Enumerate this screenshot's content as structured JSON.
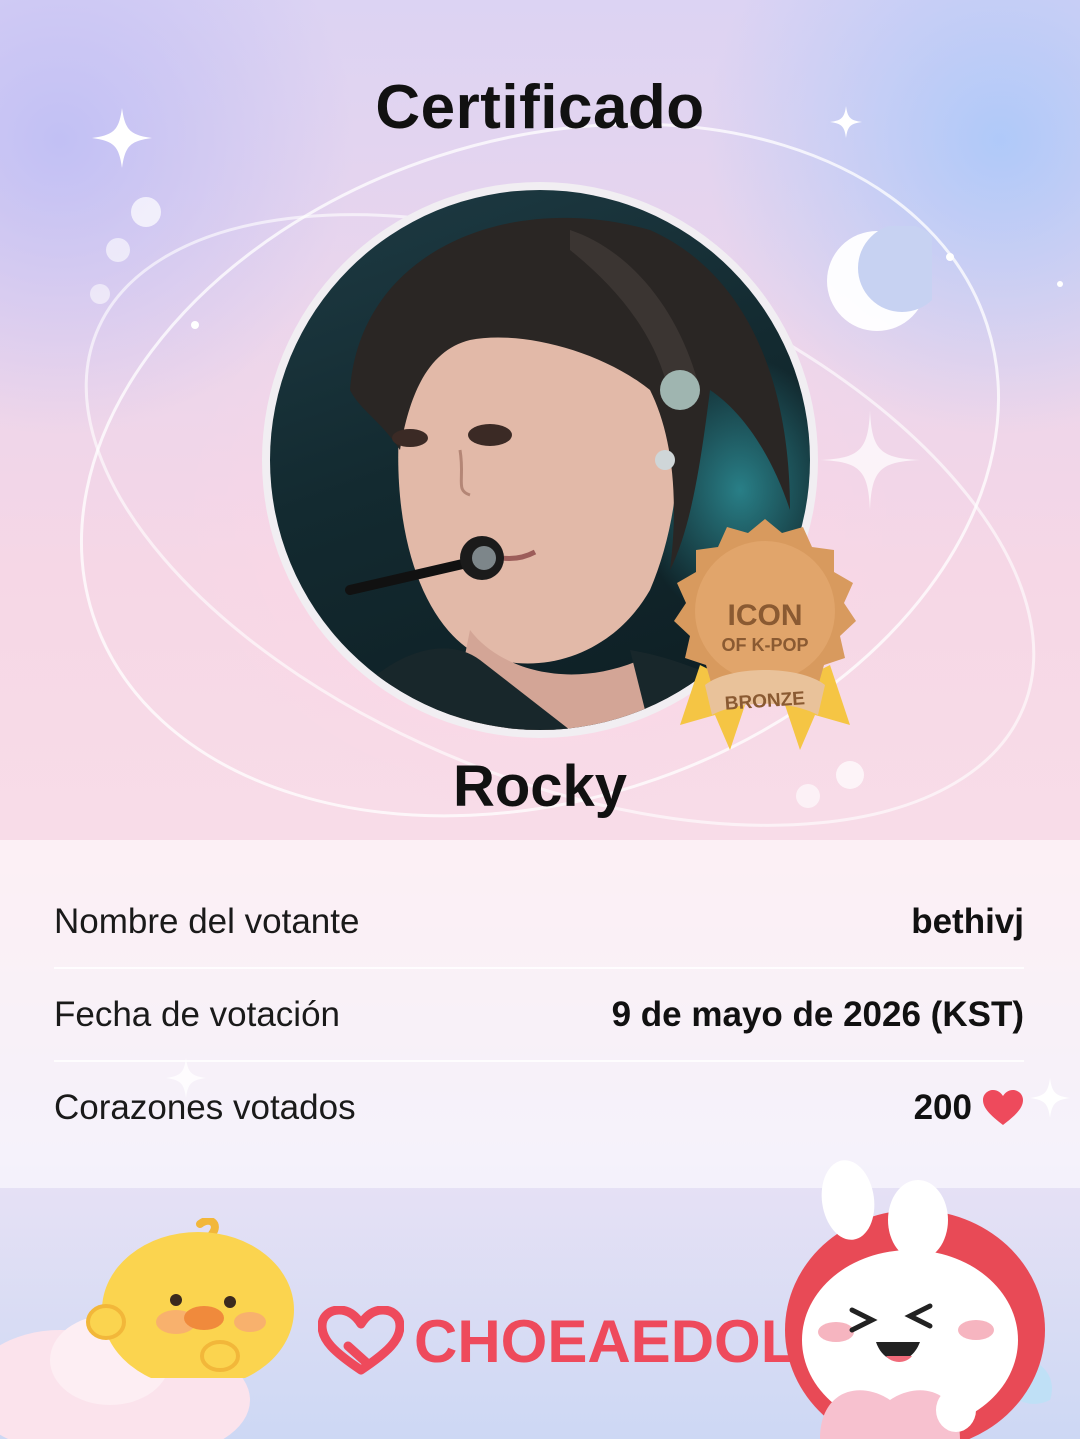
{
  "certificate": {
    "title": "Certificado",
    "idol_name": "Rocky",
    "badge": {
      "line1": "ICON",
      "line2": "OF K-POP",
      "ribbon": "BRONZE",
      "color": "#d89a5e"
    },
    "rows": [
      {
        "label": "Nombre del votante",
        "value": "bethivj"
      },
      {
        "label": "Fecha de votación",
        "value": "9 de mayo de 2026 (KST)"
      },
      {
        "label": "Corazones votados",
        "value": "200",
        "icon": "heart-icon"
      }
    ]
  },
  "brand": {
    "name": "CHOEAEDOL",
    "logo_icon": "choeaedol-heart-logo-icon",
    "color": "#ee4a5c"
  },
  "decorations": [
    "sparkle-icon",
    "crescent-moon-icon",
    "chick-mascot-icon",
    "bunny-mascot-icon",
    "cloud-icon"
  ]
}
